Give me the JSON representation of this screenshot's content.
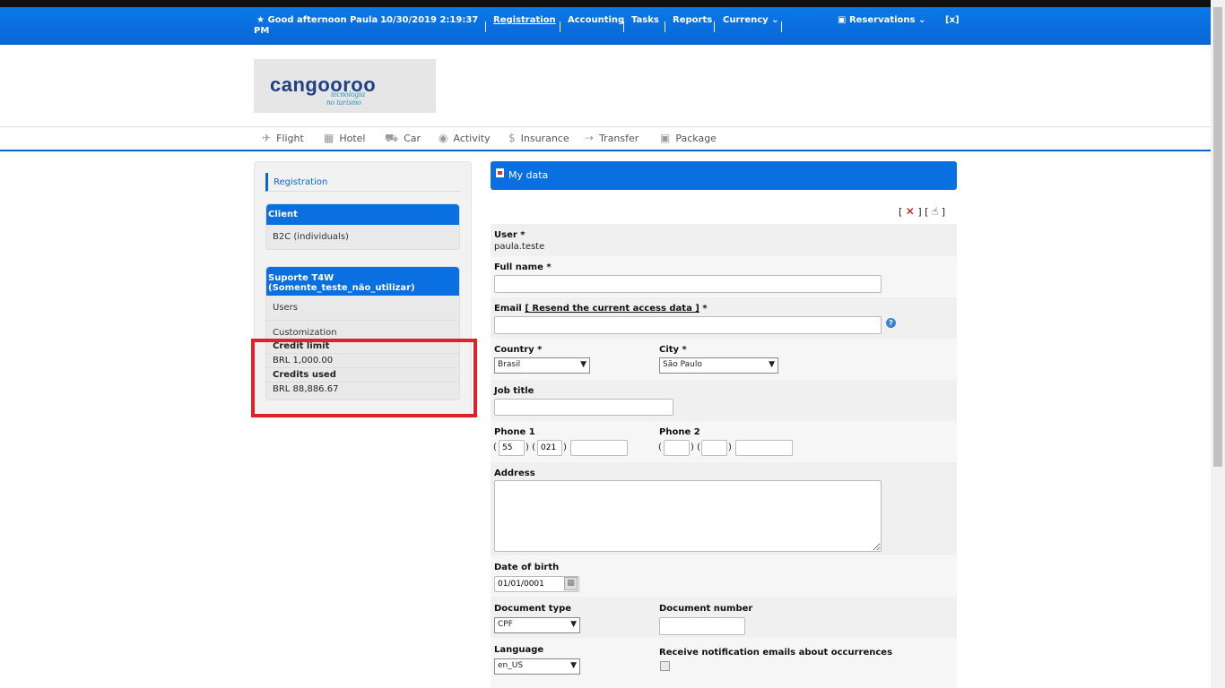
{
  "topbar": {
    "greeting": "★ Good afternoon Paula ⌄",
    "datetime_line1": "10/30/2019 2:19:37",
    "datetime_line2": "PM",
    "menu": [
      "Registration",
      "Accounting",
      "Tasks",
      "Reports",
      "Currency ⌄"
    ],
    "reservations": "Reservations ⌄",
    "close": "[x]"
  },
  "logo": {
    "name": "cangooroo",
    "tagline1": "tecnologia",
    "tagline2": "no turismo"
  },
  "nav": {
    "items": [
      {
        "label": "Flight",
        "icon": "✈"
      },
      {
        "label": "Hotel",
        "icon": "▦"
      },
      {
        "label": "Car",
        "icon": "⛟"
      },
      {
        "label": "Activity",
        "icon": "◉"
      },
      {
        "label": "Insurance",
        "icon": "$"
      },
      {
        "label": "Transfer",
        "icon": "⇢"
      },
      {
        "label": "Package",
        "icon": "▣"
      }
    ]
  },
  "sidebar": {
    "registration": "Registration",
    "client_head": "Client",
    "client_item": "B2C (individuals)",
    "support_head_1": "Suporte T4W",
    "support_head_2": "(Somente_teste_não_utilizar)",
    "support_items": [
      "Users",
      "Customization"
    ],
    "credit_limit_label": "Credit limit",
    "credit_limit_value": "BRL 1,000.00",
    "credits_used_label": "Credits used",
    "credits_used_value": "BRL 88,886.67"
  },
  "panel": {
    "title": "My data",
    "actions_open": "[",
    "actions_mid": "] [",
    "actions_close": "]"
  },
  "form": {
    "user_label": "User *",
    "user_value": "paula.teste",
    "fullname_label": "Full name *",
    "email_label": "Email",
    "email_link": "[ Resend the current access data ]",
    "email_star": "*",
    "country_label": "Country *",
    "country_value": "Brasil",
    "city_label": "City *",
    "city_value": "São Paulo",
    "job_label": "Job title",
    "phone1_label": "Phone 1",
    "phone1_country": "55",
    "phone1_area": "021",
    "phone2_label": "Phone 2",
    "address_label": "Address",
    "dob_label": "Date of birth",
    "dob_value": "01/01/0001",
    "doctype_label": "Document type",
    "doctype_value": "CPF",
    "docnum_label": "Document number",
    "language_label": "Language",
    "language_value": "en_US",
    "notif_label": "Receive notification emails about occurrences"
  }
}
